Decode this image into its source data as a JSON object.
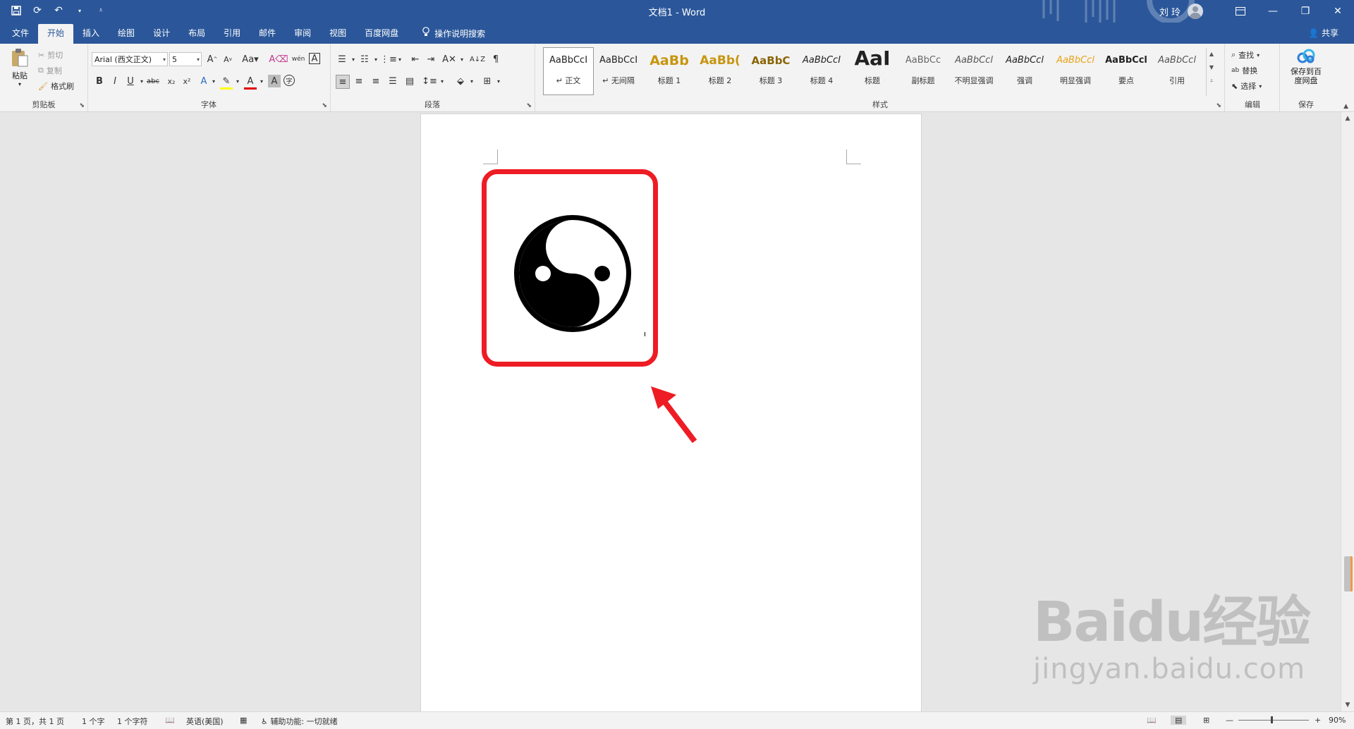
{
  "titlebar": {
    "doc_title": "文档1  -  Word",
    "user_name": "刘 玲"
  },
  "tabs": [
    "文件",
    "开始",
    "插入",
    "绘图",
    "设计",
    "布局",
    "引用",
    "邮件",
    "审阅",
    "视图",
    "百度网盘"
  ],
  "active_tab": "开始",
  "tell_me": "操作说明搜索",
  "share": "共享",
  "clipboard": {
    "paste": "粘贴",
    "cut": "剪切",
    "copy": "复制",
    "format_painter": "格式刷",
    "label": "剪贴板"
  },
  "font": {
    "name": "Arial (西文正文)",
    "size": "5",
    "label": "字体"
  },
  "paragraph": {
    "label": "段落"
  },
  "styles": {
    "label": "样式",
    "items": [
      {
        "sample": "AaBbCcI",
        "name": "↵ 正文"
      },
      {
        "sample": "AaBbCcI",
        "name": "↵ 无间隔"
      },
      {
        "sample": "AaBb",
        "name": "标题 1"
      },
      {
        "sample": "AaBb(",
        "name": "标题 2"
      },
      {
        "sample": "AaBbC",
        "name": "标题 3"
      },
      {
        "sample": "AaBbCcI",
        "name": "标题 4"
      },
      {
        "sample": "AaI",
        "name": "标题"
      },
      {
        "sample": "AaBbCc",
        "name": "副标题"
      },
      {
        "sample": "AaBbCcl",
        "name": "不明显强调"
      },
      {
        "sample": "AaBbCcl",
        "name": "强调"
      },
      {
        "sample": "AaBbCcl",
        "name": "明显强调"
      },
      {
        "sample": "AaBbCcl",
        "name": "要点"
      },
      {
        "sample": "AaBbCcl",
        "name": "引用"
      }
    ]
  },
  "editing": {
    "find": "查找",
    "replace": "替换",
    "select": "选择",
    "label": "编辑"
  },
  "save_group": {
    "button": "保存到百度网盘",
    "label": "保存"
  },
  "status": {
    "page": "第 1 页，共 1 页",
    "words": "1 个字",
    "chars": "1 个字符",
    "language": "英语(美国)",
    "accessibility": "辅助功能: 一切就绪",
    "zoom": "90%"
  },
  "watermark": {
    "main": "Baidu经验",
    "url": "jingyan.baidu.com"
  },
  "colors": {
    "brand": "#2b579a",
    "annotation": "#ee1c24"
  }
}
